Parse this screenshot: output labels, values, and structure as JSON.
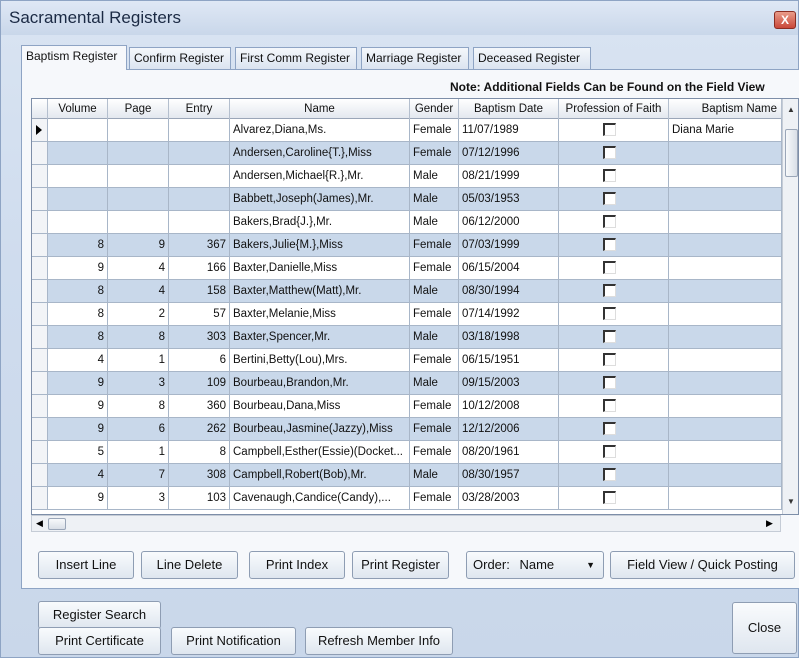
{
  "window": {
    "title": "Sacramental Registers",
    "close_glyph": "X"
  },
  "tabs": [
    {
      "label": "Baptism Register",
      "active": true
    },
    {
      "label": "Confirm Register",
      "active": false
    },
    {
      "label": "First Comm Register",
      "active": false
    },
    {
      "label": "Marriage Register",
      "active": false
    },
    {
      "label": "Deceased Register",
      "active": false
    }
  ],
  "note": "Note: Additional Fields Can be Found on the Field View",
  "grid": {
    "columns": [
      "Volume",
      "Page",
      "Entry",
      "Name",
      "Gender",
      "Baptism Date",
      "Profession of Faith",
      "Baptism Name"
    ],
    "rows": [
      {
        "volume": "",
        "page": "",
        "entry": "",
        "name": "Alvarez,Diana,Ms.",
        "gender": "Female",
        "date": "11/07/1989",
        "pof": false,
        "bname": "Diana Marie",
        "current": true
      },
      {
        "volume": "",
        "page": "",
        "entry": "",
        "name": "Andersen,Caroline{T.},Miss",
        "gender": "Female",
        "date": "07/12/1996",
        "pof": false,
        "bname": ""
      },
      {
        "volume": "",
        "page": "",
        "entry": "",
        "name": "Andersen,Michael{R.},Mr.",
        "gender": "Male",
        "date": "08/21/1999",
        "pof": false,
        "bname": ""
      },
      {
        "volume": "",
        "page": "",
        "entry": "",
        "name": "Babbett,Joseph(James),Mr.",
        "gender": "Male",
        "date": "05/03/1953",
        "pof": false,
        "bname": ""
      },
      {
        "volume": "",
        "page": "",
        "entry": "",
        "name": "Bakers,Brad{J.},Mr.",
        "gender": "Male",
        "date": "06/12/2000",
        "pof": false,
        "bname": ""
      },
      {
        "volume": "8",
        "page": "9",
        "entry": "367",
        "name": "Bakers,Julie{M.},Miss",
        "gender": "Female",
        "date": "07/03/1999",
        "pof": false,
        "bname": ""
      },
      {
        "volume": "9",
        "page": "4",
        "entry": "166",
        "name": "Baxter,Danielle,Miss",
        "gender": "Female",
        "date": "06/15/2004",
        "pof": false,
        "bname": ""
      },
      {
        "volume": "8",
        "page": "4",
        "entry": "158",
        "name": "Baxter,Matthew(Matt),Mr.",
        "gender": "Male",
        "date": "08/30/1994",
        "pof": false,
        "bname": ""
      },
      {
        "volume": "8",
        "page": "2",
        "entry": "57",
        "name": "Baxter,Melanie,Miss",
        "gender": "Female",
        "date": "07/14/1992",
        "pof": false,
        "bname": ""
      },
      {
        "volume": "8",
        "page": "8",
        "entry": "303",
        "name": "Baxter,Spencer,Mr.",
        "gender": "Male",
        "date": "03/18/1998",
        "pof": false,
        "bname": ""
      },
      {
        "volume": "4",
        "page": "1",
        "entry": "6",
        "name": "Bertini,Betty(Lou),Mrs.",
        "gender": "Female",
        "date": "06/15/1951",
        "pof": false,
        "bname": ""
      },
      {
        "volume": "9",
        "page": "3",
        "entry": "109",
        "name": "Bourbeau,Brandon,Mr.",
        "gender": "Male",
        "date": "09/15/2003",
        "pof": false,
        "bname": ""
      },
      {
        "volume": "9",
        "page": "8",
        "entry": "360",
        "name": "Bourbeau,Dana,Miss",
        "gender": "Female",
        "date": "10/12/2008",
        "pof": false,
        "bname": ""
      },
      {
        "volume": "9",
        "page": "6",
        "entry": "262",
        "name": "Bourbeau,Jasmine(Jazzy),Miss",
        "gender": "Female",
        "date": "12/12/2006",
        "pof": false,
        "bname": ""
      },
      {
        "volume": "5",
        "page": "1",
        "entry": "8",
        "name": "Campbell,Esther(Essie)(Docket...",
        "gender": "Female",
        "date": "08/20/1961",
        "pof": false,
        "bname": ""
      },
      {
        "volume": "4",
        "page": "7",
        "entry": "308",
        "name": "Campbell,Robert(Bob),Mr.",
        "gender": "Male",
        "date": "08/30/1957",
        "pof": false,
        "bname": ""
      },
      {
        "volume": "9",
        "page": "3",
        "entry": "103",
        "name": "Cavenaugh,Candice(Candy),...",
        "gender": "Female",
        "date": "03/28/2003",
        "pof": false,
        "bname": ""
      }
    ]
  },
  "buttons": {
    "insert_line": "Insert Line",
    "line_delete": "Line Delete",
    "print_index": "Print Index",
    "print_register": "Print Register",
    "order_label": "Order:",
    "order_value": "Name",
    "field_view": "Field View / Quick Posting",
    "register_search": "Register Search",
    "print_certificate": "Print Certificate",
    "print_notification": "Print Notification",
    "refresh_member": "Refresh Member Info",
    "close": "Close"
  },
  "colors": {
    "alt_row": "#c9d8ea",
    "accent": "#8ea4c4"
  }
}
